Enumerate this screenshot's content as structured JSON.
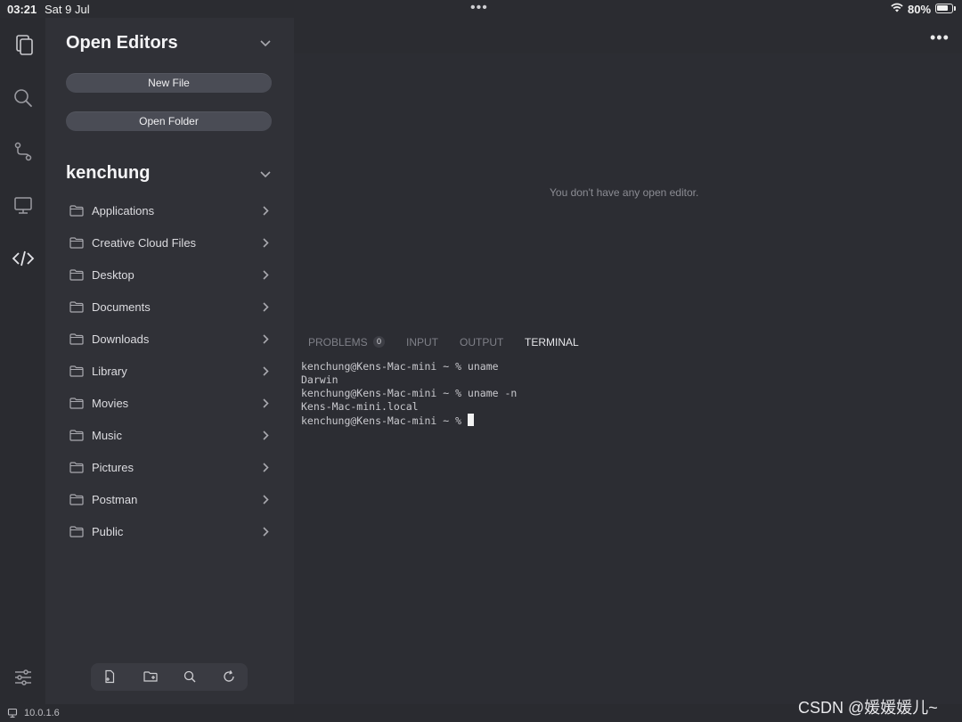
{
  "status_bar": {
    "time": "03:21",
    "date": "Sat 9 Jul",
    "dots": "•••",
    "battery": "80%"
  },
  "activity_bar": {
    "items": [
      "explorer-icon",
      "search-icon",
      "source-control-icon",
      "remote-icon",
      "code-icon"
    ],
    "bottom": "settings-sliders-icon"
  },
  "sidebar": {
    "open_editors_title": "Open Editors",
    "new_file_label": "New File",
    "open_folder_label": "Open Folder",
    "workspace_title": "kenchung",
    "folders": [
      "Applications",
      "Creative Cloud Files",
      "Desktop",
      "Documents",
      "Downloads",
      "Library",
      "Movies",
      "Music",
      "Pictures",
      "Postman",
      "Public"
    ],
    "toolbar": [
      "new-file-icon",
      "new-folder-icon",
      "search-icon",
      "refresh-icon"
    ]
  },
  "editor": {
    "more_label": "•••",
    "empty_message": "You don't have any open editor."
  },
  "panel": {
    "tabs": {
      "problems": "PROBLEMS",
      "problems_count": "0",
      "input": "INPUT",
      "output": "OUTPUT",
      "terminal": "TERMINAL"
    },
    "active_tab": "TERMINAL",
    "terminal_lines": [
      "kenchung@Kens-Mac-mini ~ % uname",
      "Darwin",
      "kenchung@Kens-Mac-mini ~ % uname -n",
      "Kens-Mac-mini.local",
      "kenchung@Kens-Mac-mini ~ % "
    ]
  },
  "bottom_bar": {
    "version": "10.0.1.6",
    "watermark": "CSDN @媛媛媛儿~"
  },
  "colors": {
    "background": "#2b2c31",
    "sidebar": "#303137",
    "button": "#4a4c55"
  }
}
